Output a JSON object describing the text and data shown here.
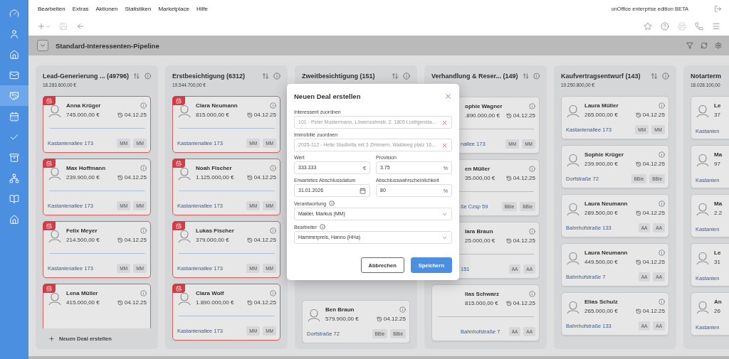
{
  "sidebar": {
    "items": [
      {
        "selected": false
      },
      {
        "selected": false
      },
      {
        "selected": false
      },
      {
        "selected": false
      },
      {
        "selected": true
      },
      {
        "selected": false
      },
      {
        "selected": false
      },
      {
        "selected": false
      },
      {
        "selected": false
      },
      {
        "selected": false
      },
      {
        "selected": false
      }
    ]
  },
  "menu": [
    "Bearbeiten",
    "Extras",
    "Aktionen",
    "Statistiken",
    "Marketplace",
    "Hilfe"
  ],
  "edition": "onOffice enterprise edition BETA",
  "toolbar": {
    "left": [
      {
        "disabled": false
      },
      {
        "disabled": true
      },
      {
        "disabled": false
      }
    ],
    "right": [
      {
        "disabled": false
      },
      {
        "disabled": false
      },
      {
        "disabled": true
      },
      {
        "disabled": false
      },
      {
        "disabled": false
      }
    ]
  },
  "pipeline": {
    "title": "Standard-Interessenten-Pipeline"
  },
  "columns": [
    {
      "title": "Lead-Generierung ...",
      "count": "(49796)",
      "total": "18.283.600,00 €",
      "under_dialog": false,
      "add_button": "Neuen Deal erstellen",
      "cards": [
        {
          "kind": "tall",
          "overdue": true,
          "name": "Anna Krüger",
          "amount": "745.000,00 €",
          "date": "04.12.25",
          "address": "Kastanienallee 173",
          "tags": [
            "MM",
            "MM"
          ]
        },
        {
          "kind": "tall",
          "overdue": true,
          "name": "Max Hoffmann",
          "amount": "239.900,00 €",
          "date": "04.12.25",
          "address": "Kastanienallee 173",
          "tags": [
            "MM",
            "MM"
          ]
        },
        {
          "kind": "tall",
          "overdue": true,
          "name": "Felix Meyer",
          "amount": "214.500,00 €",
          "date": "04.12.25",
          "address": "Kastanienallee 173",
          "tags": [
            "MM",
            "MM"
          ]
        },
        {
          "kind": "tall",
          "overdue": true,
          "name": "Lena Müller",
          "amount": "415.000,00 €",
          "date": "04.12.25"
        }
      ]
    },
    {
      "title": "Erstbesichtigung",
      "count": "(6312)",
      "total": "19.544.700,00 €",
      "under_dialog": false,
      "cards": [
        {
          "kind": "tall",
          "overdue": true,
          "name": "Clara Neumann",
          "amount": "815.000,00 €",
          "date": "04.12.25",
          "address": "Kastanienallee 173",
          "tags": [
            "MM",
            "MM"
          ]
        },
        {
          "kind": "tall",
          "overdue": true,
          "name": "Noah Fischer",
          "amount": "1.125.000,00 €",
          "date": "04.12.25",
          "address": "Kastanienallee 173",
          "tags": [
            "MM",
            "MM"
          ]
        },
        {
          "kind": "tall",
          "overdue": true,
          "name": "Lukas Fischer",
          "amount": "379.000,00 €",
          "date": "04.12.25",
          "address": "Kastanienallee 173",
          "tags": [
            "MM",
            "MM"
          ]
        },
        {
          "kind": "tall",
          "overdue": true,
          "name": "Clara Wolf",
          "amount": "1.890.000,00 €",
          "date": "04.12.25",
          "address": "Kastanienallee 173",
          "tags": [
            "MM",
            "MM"
          ]
        }
      ]
    },
    {
      "title": "Zweitbesichtigung",
      "count": "(151)",
      "under_dialog": true,
      "cards": [
        {
          "kind": "short",
          "overdue": false,
          "name": "Ben Braun",
          "amount": "579.900,00 €",
          "date": "04.12.25",
          "address": "Dorfstraße 72",
          "tags": [
            "BBie",
            "BBie"
          ]
        }
      ]
    },
    {
      "title": "Verhandlung & Reser...",
      "count": "(149)",
      "under_dialog": true,
      "cards": [
        {
          "kind": "tall",
          "overdue": false,
          "name": "ophie Wagner",
          "amount": ".890.000,00 €",
          "date": "04.12.25",
          "address": "nallee 173",
          "tags": [
            "MM",
            "MM"
          ]
        },
        {
          "kind": "tall",
          "overdue": false,
          "name": "en Müller",
          "amount": "35.000,00 €",
          "date": "04.12.25",
          "address": "ße Czsp 59",
          "tags": [
            "BBie",
            "BBie"
          ]
        },
        {
          "kind": "tall",
          "overdue": false,
          "name": "lara Braun",
          "amount": "25.000,00 €",
          "date": "04.12.25",
          "address": "151",
          "tags": [
            "AA",
            "AA"
          ]
        },
        {
          "kind": "tall",
          "overdue": false,
          "name": "lias Schwarz",
          "amount": "815.000,00 €",
          "date": "04.12.25",
          "address": "Bahnhofstraße 7",
          "tags": [
            "AA",
            "AA"
          ]
        }
      ]
    },
    {
      "title": "Kaufvertragsentwurf",
      "count": "(143)",
      "total": "19.250.800,00 €",
      "under_dialog": false,
      "cards": [
        {
          "kind": "short",
          "overdue": false,
          "name": "Laura Müller",
          "amount": "265.000,00 €",
          "date": "04.12.25",
          "address": "Kastanienallee 173",
          "tags": [
            "MM",
            "MM"
          ]
        },
        {
          "kind": "short",
          "overdue": false,
          "name": "Sophie Krüger",
          "amount": "239.900,00 €",
          "date": "04.12.25",
          "address": "Dorfstraße 72",
          "tags": [
            "BBie",
            "BBie"
          ]
        },
        {
          "kind": "short",
          "overdue": false,
          "name": "Laura Neumann",
          "amount": "289.500,00 €",
          "date": "04.12.25",
          "address": "Bahnhofstraße 133",
          "tags": [
            "AA",
            "AA"
          ]
        },
        {
          "kind": "short",
          "overdue": false,
          "name": "Laura Neumann",
          "amount": "449.500,00 €",
          "date": "04.12.25",
          "address": "Bahnhofstraße 7",
          "tags": [
            "AA",
            "AA"
          ]
        },
        {
          "kind": "short",
          "overdue": false,
          "name": "Elias Schulz",
          "amount": "265.000,00 €",
          "date": "04.12.25",
          "address": "Bahnhofstraße 133",
          "tags": [
            "AA",
            "AA"
          ]
        }
      ]
    },
    {
      "title": "Notarterm",
      "total": "18.028.100,00",
      "under_dialog": false,
      "cards": [
        {
          "kind": "short",
          "overdue": false,
          "name": "Le",
          "amount": "37",
          "address": "Kastanien"
        },
        {
          "kind": "short",
          "overdue": false,
          "name": "Ma",
          "amount": "97",
          "address": "Kastanien"
        },
        {
          "kind": "short",
          "overdue": false,
          "name": "Ma",
          "amount": "2.2",
          "address": "Kastanien"
        },
        {
          "kind": "short",
          "overdue": false,
          "name": "Le",
          "amount": "31",
          "address": "Kastanien"
        },
        {
          "kind": "short",
          "overdue": false,
          "name": "An",
          "amount": "26",
          "address": "Kastanien"
        }
      ]
    }
  ],
  "dialog": {
    "title": "Neuen Deal erstellen",
    "fields": [
      {
        "kind": "clearable",
        "label": "Interessent zuordnen",
        "placeholder": "101 - Peter Mustermann, Löwenzahnstr. 2, 1805 Lustigensta...",
        "info": false
      },
      {
        "kind": "clearable",
        "label": "Immobilie zuordnen",
        "placeholder": "2025-112 - Helle Stadtvilla mit 3 Zimmern, Waldweg platz 16...",
        "info": false
      },
      {
        "kind": "suffix",
        "label": "Wert",
        "value": "333.333",
        "suffix": "€",
        "info": false
      },
      {
        "kind": "suffix",
        "label": "Provision",
        "value": "3.75",
        "suffix": "%",
        "info": false
      },
      {
        "kind": "date",
        "label": "Erwartetes Abschlussdatum",
        "value": "31.01.2026",
        "info": false
      },
      {
        "kind": "suffix",
        "label": "Abschlusswahrscheinlichkeit",
        "value": "80",
        "suffix": "%",
        "info": false
      },
      {
        "kind": "select",
        "label": "Verantwortung",
        "value": "Makler, Markus (MM)",
        "info": true
      },
      {
        "kind": "select",
        "label": "Bearbeiter",
        "value": "Hammerpreis, Hanno (HHa)",
        "info": true
      }
    ],
    "buttons": [
      {
        "kind": "secondary",
        "label": "Abbrechen"
      },
      {
        "kind": "primary",
        "label": "Speichern"
      }
    ]
  }
}
